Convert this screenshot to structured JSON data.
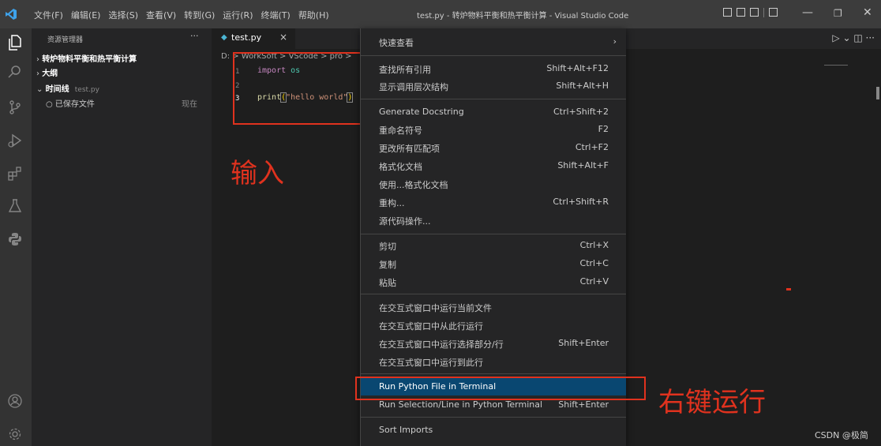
{
  "titlebar": {
    "menu": [
      "文件(F)",
      "编辑(E)",
      "选择(S)",
      "查看(V)",
      "转到(G)",
      "运行(R)",
      "终端(T)",
      "帮助(H)"
    ],
    "window_title": "test.py - 转炉物料平衡和热平衡计算 - Visual Studio Code"
  },
  "sidebar": {
    "title": "资源管理器",
    "more": "···",
    "project": "转炉物料平衡和热平衡计算",
    "outline": "大纲",
    "timeline": "时间线",
    "timeline_file": "test.py",
    "saved_entry": "已保存文件",
    "saved_time": "现在"
  },
  "editor": {
    "tab_name": "test.py",
    "tab_close": "×",
    "breadcrumb": "D: > WorkSoft > VScode > pro >",
    "line_numbers": [
      "1",
      "2",
      "3"
    ],
    "line1_kw": "import",
    "line1_mod": "os",
    "line3_fn": "print",
    "line3_open": "(",
    "line3_str": "\"hello world\"",
    "line3_close": ")"
  },
  "context_menu": {
    "peek": "快速查看",
    "items": [
      {
        "label": "查找所有引用",
        "key": "Shift+Alt+F12"
      },
      {
        "label": "显示调用层次结构",
        "key": "Shift+Alt+H"
      },
      {
        "label": "Generate Docstring",
        "key": "Ctrl+Shift+2"
      },
      {
        "label": "重命名符号",
        "key": "F2"
      },
      {
        "label": "更改所有匹配项",
        "key": "Ctrl+F2"
      },
      {
        "label": "格式化文档",
        "key": "Shift+Alt+F"
      },
      {
        "label": "使用...格式化文档",
        "key": ""
      },
      {
        "label": "重构...",
        "key": "Ctrl+Shift+R"
      },
      {
        "label": "源代码操作...",
        "key": ""
      },
      {
        "label": "剪切",
        "key": "Ctrl+X"
      },
      {
        "label": "复制",
        "key": "Ctrl+C"
      },
      {
        "label": "粘贴",
        "key": "Ctrl+V"
      },
      {
        "label": "在交互式窗口中运行当前文件",
        "key": ""
      },
      {
        "label": "在交互式窗口中从此行运行",
        "key": ""
      },
      {
        "label": "在交互式窗口中运行选择部分/行",
        "key": "Shift+Enter"
      },
      {
        "label": "在交互式窗口中运行到此行",
        "key": ""
      },
      {
        "label": "Run Python File in Terminal",
        "key": ""
      },
      {
        "label": "Run Selection/Line in Python Terminal",
        "key": "Shift+Enter"
      },
      {
        "label": "Sort Imports",
        "key": ""
      }
    ]
  },
  "annotations": {
    "input": "输入",
    "right_click_run": "右键运行",
    "watermark": "CSDN @极简"
  },
  "colors": {
    "accent_red": "#e0321e",
    "highlight": "#094771"
  }
}
